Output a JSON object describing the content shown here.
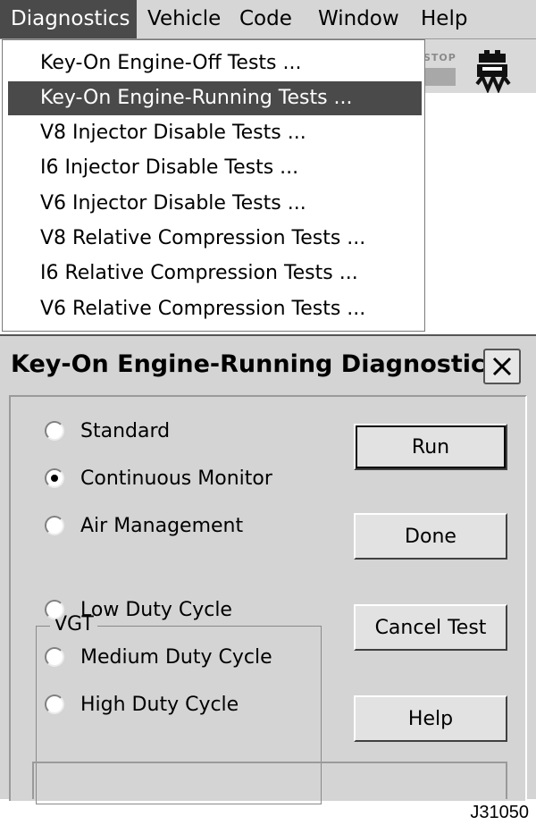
{
  "menubar": {
    "items": [
      {
        "label": "Diagnostics"
      },
      {
        "label": "Vehicle"
      },
      {
        "label": "Code"
      },
      {
        "label": "Window"
      },
      {
        "label": "Help"
      }
    ]
  },
  "toolbar": {
    "stop_label": "STOP",
    "icons": [
      "engine-icon",
      "wave-icon"
    ]
  },
  "dropdown": {
    "items": [
      {
        "label": "Key-On Engine-Off Tests ..."
      },
      {
        "label": "Key-On Engine-Running Tests ..."
      },
      {
        "label": "V8 Injector Disable Tests ..."
      },
      {
        "label": "I6 Injector Disable Tests ..."
      },
      {
        "label": "V6 Injector Disable Tests ..."
      },
      {
        "label": "V8 Relative Compression Tests ..."
      },
      {
        "label": "I6 Relative Compression Tests ..."
      },
      {
        "label": "V6 Relative Compression Tests ..."
      }
    ],
    "selected_index": 1
  },
  "dialog": {
    "title": "Key-On Engine-Running Diagnostics",
    "options": [
      {
        "label": "Standard",
        "checked": false
      },
      {
        "label": "Continuous Monitor",
        "checked": true
      },
      {
        "label": "Air Management",
        "checked": false
      }
    ],
    "vgt_group": {
      "label": "VGT",
      "options": [
        {
          "label": "Low Duty Cycle",
          "checked": false
        },
        {
          "label": "Medium Duty Cycle",
          "checked": false
        },
        {
          "label": "High Duty Cycle",
          "checked": false
        }
      ]
    },
    "buttons": {
      "run": "Run",
      "done": "Done",
      "cancel": "Cancel Test",
      "help": "Help"
    }
  },
  "figure_id": "J31050",
  "colors": {
    "menu_highlight": "#4a4a4a",
    "dialog_bg": "#d4d4d4"
  }
}
